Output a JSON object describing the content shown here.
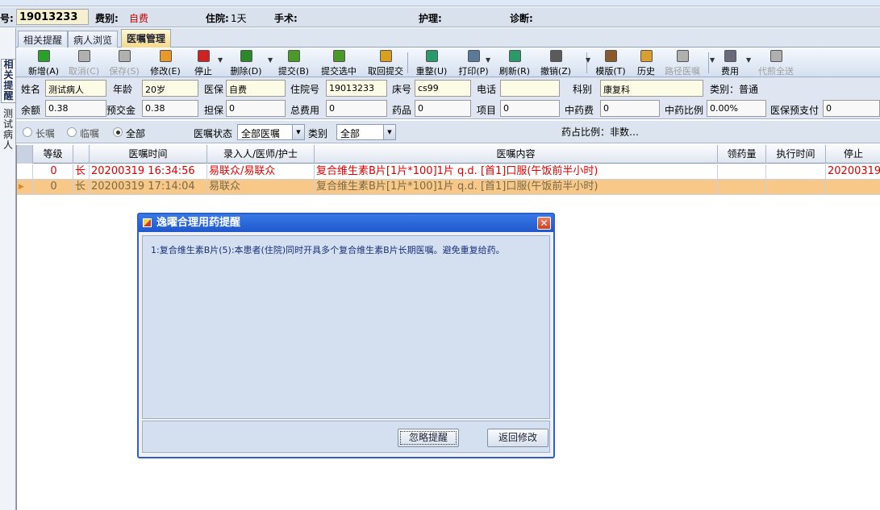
{
  "info": {
    "pid_label": "号:",
    "pid_value": "19013233",
    "fee_label": "费别:",
    "fee_value": "自费",
    "stay_label": "住院:",
    "stay_value": "1天",
    "surgery_label": "手术:",
    "nursing_label": "护理:",
    "diagnosis_label": "诊断:"
  },
  "left_tabs": {
    "related": "相关提醒",
    "patient": "测试病人"
  },
  "tabs": [
    "相关提醒",
    "病人浏览",
    "医嘱管理"
  ],
  "toolbar": [
    {
      "label": "新增(A)",
      "icon": "plus-circle-icon",
      "color": "#2aa02a",
      "enabled": true
    },
    {
      "label": "取消(C)",
      "icon": "undo-icon",
      "color": "#b0b0b0",
      "enabled": false
    },
    {
      "label": "保存(S)",
      "icon": "save-icon",
      "color": "#b0b0b0",
      "enabled": false
    },
    {
      "label": "修改(E)",
      "icon": "edit-icon",
      "color": "#e79a2a",
      "enabled": true
    },
    {
      "label": "停止",
      "icon": "stop-icon",
      "color": "#d02020",
      "enabled": true
    },
    {
      "label": "删除(D)",
      "icon": "delete-icon",
      "color": "#2a8a2a",
      "enabled": true
    },
    {
      "label": "提交(B)",
      "icon": "submit-icon",
      "color": "#4a9a2a",
      "enabled": true
    },
    {
      "label": "提交选中",
      "icon": "submit-selected-icon",
      "color": "#4a9a2a",
      "enabled": true
    },
    {
      "label": "取回提交",
      "icon": "retrieve-icon",
      "color": "#d8a020",
      "enabled": true
    },
    {
      "label": "重整(U)",
      "icon": "refresh-doc-icon",
      "color": "#2a9a6a",
      "enabled": true
    },
    {
      "label": "打印(P)",
      "icon": "print-icon",
      "color": "#5a7a9a",
      "enabled": true
    },
    {
      "label": "刷新(R)",
      "icon": "reload-icon",
      "color": "#2a9a6a",
      "enabled": true
    },
    {
      "label": "撤销(Z)",
      "icon": "trash-icon",
      "color": "#5a5a5a",
      "enabled": true
    },
    {
      "label": "模版(T)",
      "icon": "template-icon",
      "color": "#8a5a2a",
      "enabled": true
    },
    {
      "label": "历史",
      "icon": "history-icon",
      "color": "#d8a030",
      "enabled": true
    },
    {
      "label": "路径医嘱",
      "icon": "path-icon",
      "color": "#b0b0b0",
      "enabled": false
    },
    {
      "label": "费用",
      "icon": "calculator-icon",
      "color": "#6a6a7a",
      "enabled": true
    },
    {
      "label": "代煎全送",
      "icon": "decoct-icon",
      "color": "#b0b0b0",
      "enabled": false
    }
  ],
  "form": {
    "name_label": "姓名",
    "name_value": "测试病人",
    "age_label": "年龄",
    "age_value": "20岁",
    "insurance_label": "医保",
    "insurance_value": "自费",
    "admission_label": "住院号",
    "admission_value": "19013233",
    "bed_label": "床号",
    "bed_value": "cs99",
    "phone_label": "电话",
    "phone_value": "",
    "dept_label": "科别",
    "dept_value": "康复科",
    "category_text": "类别：普通",
    "balance_label": "余额",
    "balance_value": "0.38",
    "prepaid_label": "预交金",
    "prepaid_value": "0.38",
    "guarantee_label": "担保",
    "guarantee_value": "0",
    "total_label": "总费用",
    "total_value": "0",
    "drug_label": "药品",
    "drug_value": "0",
    "item_label": "项目",
    "item_value": "0",
    "tcm_label": "中药费",
    "tcm_value": "0",
    "tcm_ratio_label": "中药比例",
    "tcm_ratio_value": "0.00%",
    "ins_prepay_label": "医保预支付",
    "ins_prepay_value": "0"
  },
  "filter": {
    "long_label": "长嘱",
    "temp_label": "临嘱",
    "all_label": "全部",
    "status_label": "医嘱状态",
    "status_value": "全部医嘱",
    "type_label": "类别",
    "type_value": "全部",
    "drug_ratio": "药占比例：非数…"
  },
  "grid": {
    "headers": [
      "等级",
      "医嘱时间",
      "录入人/医师/护士",
      "医嘱内容",
      "领药量",
      "执行时间",
      "停止"
    ],
    "rows": [
      {
        "level": "0",
        "type": "长",
        "time": "20200319 16:34:56",
        "staff": "易联众/易联众",
        "content": "复合维生素B片[1片*100]1片 q.d. [首1]口服(午饭前半小时)",
        "qty": "",
        "exec": "",
        "stop": "20200319"
      },
      {
        "level": "0",
        "type": "长",
        "time": "20200319 17:14:04",
        "staff": "易联众",
        "content": "复合维生素B片[1片*100]1片 q.d. [首1]口服(午饭前半小时)",
        "qty": "",
        "exec": "",
        "stop": ""
      }
    ]
  },
  "dialog": {
    "title": "逸曜合理用药提醒",
    "message": "1:复合维生素B片(5):本患者(住院)同时开具多个复合维生素B片长期医嘱。避免重复给药。",
    "ignore_button": "忽略提醒",
    "back_button": "返回修改",
    "close_icon": "close-icon"
  }
}
